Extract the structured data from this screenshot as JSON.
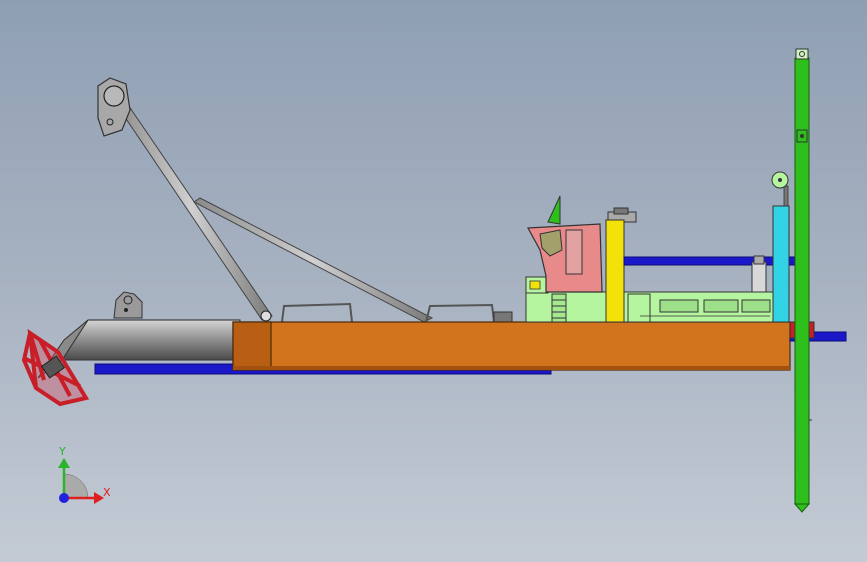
{
  "colors": {
    "hull": "#d2741e",
    "hull_dark": "#b85f14",
    "cutter": "#c81e28",
    "spud": "#2fbf1c",
    "cabin": "#e98a8a",
    "deck_house": "#b5f5a0",
    "exhaust": "#f2e20a",
    "hydraulic_cylinder": "#33d3e6",
    "pipe_blue": "#1a18c8",
    "steel_gray": "#9a9a9a"
  },
  "axis_triad": {
    "y_label": "Y",
    "x_label": "X",
    "y_color": "#2ab42a",
    "x_color": "#e02020",
    "z_color": "#2020e0"
  }
}
